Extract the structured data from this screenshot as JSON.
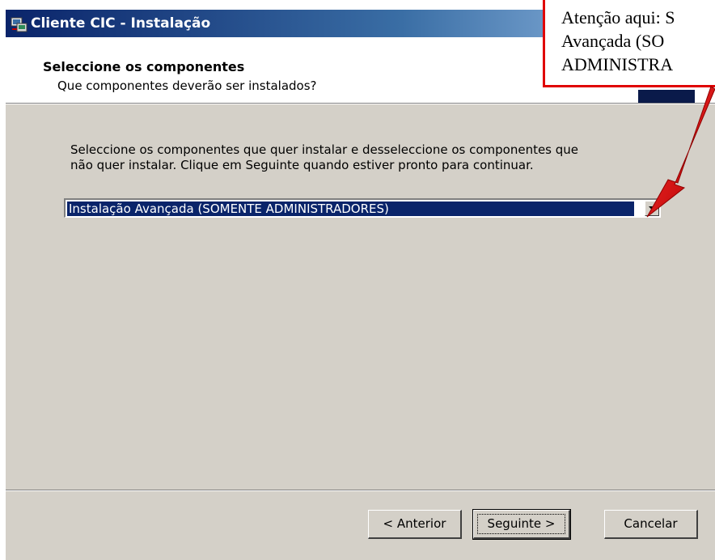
{
  "window": {
    "title": "Cliente CIC - Instalação"
  },
  "header": {
    "title": "Seleccione os componentes",
    "subtitle": "Que componentes deverão ser instalados?"
  },
  "main": {
    "instructions_line1": "Seleccione os componentes que quer instalar e desseleccione os componentes que",
    "instructions_line2": "não quer instalar. Clique em Seguinte quando estiver pronto para continuar.",
    "install_type": {
      "selected_value": "Instalação Avançada (SOMENTE ADMINISTRADORES)"
    }
  },
  "footer": {
    "back_label": "< Anterior",
    "next_label": "Seguinte >",
    "cancel_label": "Cancelar"
  },
  "annotation": {
    "line1": "Atenção aqui: S",
    "line2": "Avançada (SO",
    "line3": "ADMINISTRA",
    "color": "#e00000"
  },
  "colors": {
    "title_bar": "#0a246a",
    "selection": "#0a246a",
    "dialog_face": "#d4d0c8",
    "annotation_border": "#e00000"
  },
  "icons": [
    "setup-app-icon",
    "dropdown-arrow-icon",
    "annotation-arrow"
  ]
}
